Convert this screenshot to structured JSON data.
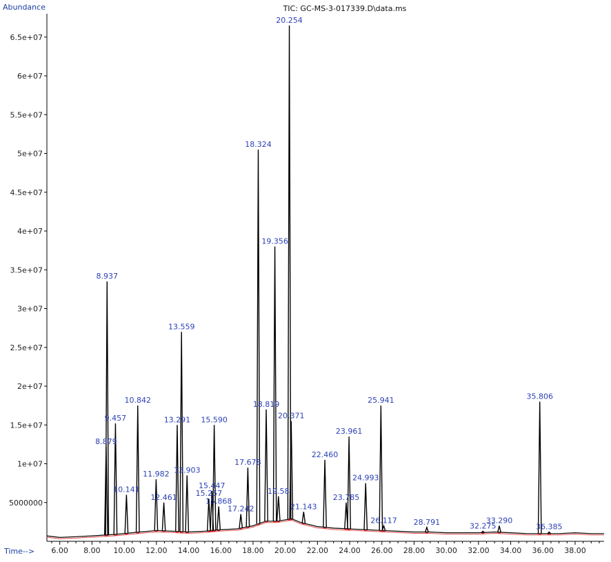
{
  "chart_data": {
    "type": "line",
    "title": "TIC: GC-MS-3-017339.D\\data.ms",
    "ylabel": "Abundance",
    "xlabel": "Time-->",
    "xlim": [
      5.2,
      39.8
    ],
    "ylim": [
      0,
      68000000
    ],
    "x_ticks": [
      6,
      8,
      10,
      12,
      14,
      16,
      18,
      20,
      22,
      24,
      26,
      28,
      30,
      32,
      34,
      36,
      38
    ],
    "x_tick_labels": [
      "6.00",
      "8.00",
      "10.00",
      "12.00",
      "14.00",
      "16.00",
      "18.00",
      "20.00",
      "22.00",
      "24.00",
      "26.00",
      "28.00",
      "30.00",
      "32.00",
      "34.00",
      "36.00",
      "38.00"
    ],
    "y_ticks": [
      5000000,
      10000000,
      15000000,
      20000000,
      25000000,
      30000000,
      35000000,
      40000000,
      45000000,
      50000000,
      55000000,
      60000000,
      65000000
    ],
    "y_tick_labels": [
      "5000000",
      "1e+07",
      "1.5e+07",
      "2e+07",
      "2.5e+07",
      "3e+07",
      "3.5e+07",
      "4e+07",
      "4.5e+07",
      "5e+07",
      "5.5e+07",
      "6e+07",
      "6.5e+07"
    ],
    "series_color": "#000000",
    "integration_color": "#e02020",
    "label_color": "#2a3fb5",
    "baseline": [
      [
        5.2,
        700000
      ],
      [
        6.0,
        500000
      ],
      [
        7.0,
        600000
      ],
      [
        8.0,
        700000
      ],
      [
        9.5,
        900000
      ],
      [
        11.0,
        1200000
      ],
      [
        12.0,
        1400000
      ],
      [
        13.0,
        1300000
      ],
      [
        14.0,
        1200000
      ],
      [
        15.0,
        1300000
      ],
      [
        16.0,
        1500000
      ],
      [
        17.0,
        1600000
      ],
      [
        18.0,
        2000000
      ],
      [
        18.8,
        2600000
      ],
      [
        19.5,
        2600000
      ],
      [
        20.4,
        2900000
      ],
      [
        21.0,
        2400000
      ],
      [
        22.0,
        1900000
      ],
      [
        23.0,
        1700000
      ],
      [
        24.0,
        1600000
      ],
      [
        25.0,
        1500000
      ],
      [
        26.0,
        1400000
      ],
      [
        27.0,
        1300000
      ],
      [
        28.0,
        1200000
      ],
      [
        29.0,
        1200000
      ],
      [
        30.0,
        1100000
      ],
      [
        31.0,
        1100000
      ],
      [
        32.0,
        1100000
      ],
      [
        33.0,
        1200000
      ],
      [
        34.0,
        1100000
      ],
      [
        35.0,
        1000000
      ],
      [
        36.0,
        1000000
      ],
      [
        37.0,
        1000000
      ],
      [
        38.0,
        1100000
      ],
      [
        39.0,
        1000000
      ],
      [
        39.8,
        1000000
      ]
    ],
    "peaks": [
      {
        "rt": 8.879,
        "abundance": 12200000,
        "label": "8.879"
      },
      {
        "rt": 8.937,
        "abundance": 33500000,
        "label": "8.937"
      },
      {
        "rt": 9.457,
        "abundance": 15200000,
        "label": "9.457"
      },
      {
        "rt": 10.141,
        "abundance": 6000000,
        "label": "10.141"
      },
      {
        "rt": 10.842,
        "abundance": 17500000,
        "label": "10.842"
      },
      {
        "rt": 11.982,
        "abundance": 8000000,
        "label": "11.982"
      },
      {
        "rt": 12.461,
        "abundance": 5000000,
        "label": "12.461"
      },
      {
        "rt": 13.291,
        "abundance": 15000000,
        "label": "13.291"
      },
      {
        "rt": 13.559,
        "abundance": 27000000,
        "label": "13.559"
      },
      {
        "rt": 13.903,
        "abundance": 8500000,
        "label": "13.903"
      },
      {
        "rt": 15.257,
        "abundance": 5500000,
        "label": "15.257"
      },
      {
        "rt": 15.447,
        "abundance": 6500000,
        "label": "15.447"
      },
      {
        "rt": 15.59,
        "abundance": 15000000,
        "label": "15.590"
      },
      {
        "rt": 15.868,
        "abundance": 4500000,
        "label": "15.868"
      },
      {
        "rt": 17.242,
        "abundance": 3500000,
        "label": "17.242"
      },
      {
        "rt": 17.678,
        "abundance": 9500000,
        "label": "17.678"
      },
      {
        "rt": 18.324,
        "abundance": 50500000,
        "label": "18.324"
      },
      {
        "rt": 18.819,
        "abundance": 17000000,
        "label": "18.819"
      },
      {
        "rt": 19.356,
        "abundance": 38000000,
        "label": "19.356"
      },
      {
        "rt": 19.58,
        "abundance": 5800000,
        "label": "19.58"
      },
      {
        "rt": 20.254,
        "abundance": 66500000,
        "label": "20.254"
      },
      {
        "rt": 20.371,
        "abundance": 15500000,
        "label": "20.371"
      },
      {
        "rt": 21.143,
        "abundance": 3800000,
        "label": "21.143"
      },
      {
        "rt": 22.46,
        "abundance": 10500000,
        "label": "22.460"
      },
      {
        "rt": 23.785,
        "abundance": 5000000,
        "label": "23.785"
      },
      {
        "rt": 23.961,
        "abundance": 13500000,
        "label": "23.961"
      },
      {
        "rt": 24.993,
        "abundance": 7500000,
        "label": "24.993"
      },
      {
        "rt": 25.941,
        "abundance": 17500000,
        "label": "25.941"
      },
      {
        "rt": 26.117,
        "abundance": 2000000,
        "label": "26.117"
      },
      {
        "rt": 28.791,
        "abundance": 1800000,
        "label": "28.791"
      },
      {
        "rt": 32.275,
        "abundance": 1300000,
        "label": "32.275"
      },
      {
        "rt": 33.29,
        "abundance": 2000000,
        "label": "33.290"
      },
      {
        "rt": 35.806,
        "abundance": 18000000,
        "label": "35.806"
      },
      {
        "rt": 36.385,
        "abundance": 1200000,
        "label": "36.385"
      }
    ]
  }
}
